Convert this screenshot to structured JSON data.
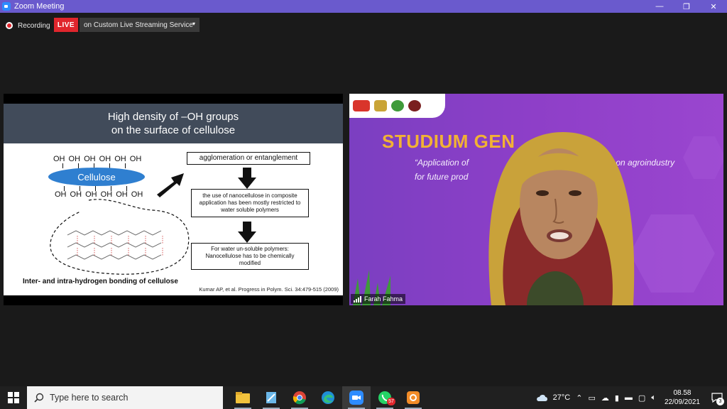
{
  "window": {
    "title": "Zoom Meeting",
    "minimize_glyph": "—",
    "restore_glyph": "❐",
    "close_glyph": "✕"
  },
  "recording": {
    "label": "Recording",
    "live_badge": "LIVE",
    "stream_service": "on Custom Live Streaming Service",
    "caret": "▾"
  },
  "slide": {
    "title_line1": "High density of –OH groups",
    "title_line2": "on the surface of cellulose",
    "oh_top": "OH OH OH OH OH OH",
    "oh_bottom": "OH OH OH OH OH OH",
    "cellulose_label": "Cellulose",
    "box1": "agglomeration or entanglement",
    "box2": "the use of nanocellulose in composite application has been mostly restricted to water soluble polymers",
    "box3": "For water un-soluble polymers: Nanocellulose has to be chemically modified",
    "caption": "Inter- and intra-hydrogen bonding of cellulose",
    "reference": "Kumar AP, et al. Progress in Polym. Sci. 34:479-515 (2009)"
  },
  "video": {
    "heading": "STUDIUM GEN",
    "subtitle_line1_left": "“Application of",
    "subtitle_line1_right": "s based on agroindustry",
    "subtitle_line2": "for future prod",
    "participant_name": "Farah Fahma",
    "accent_color": "#f2b234"
  },
  "taskbar": {
    "search_placeholder": "Type here to search",
    "whatsapp_badge": "57",
    "weather": "27°C",
    "time": "08.58",
    "date": "22/09/2021",
    "notification_count": "3",
    "apps": [
      "file-explorer-icon",
      "notepad-icon",
      "chrome-icon",
      "edge-icon",
      "zoom-icon",
      "whatsapp-icon",
      "app-icon"
    ]
  }
}
